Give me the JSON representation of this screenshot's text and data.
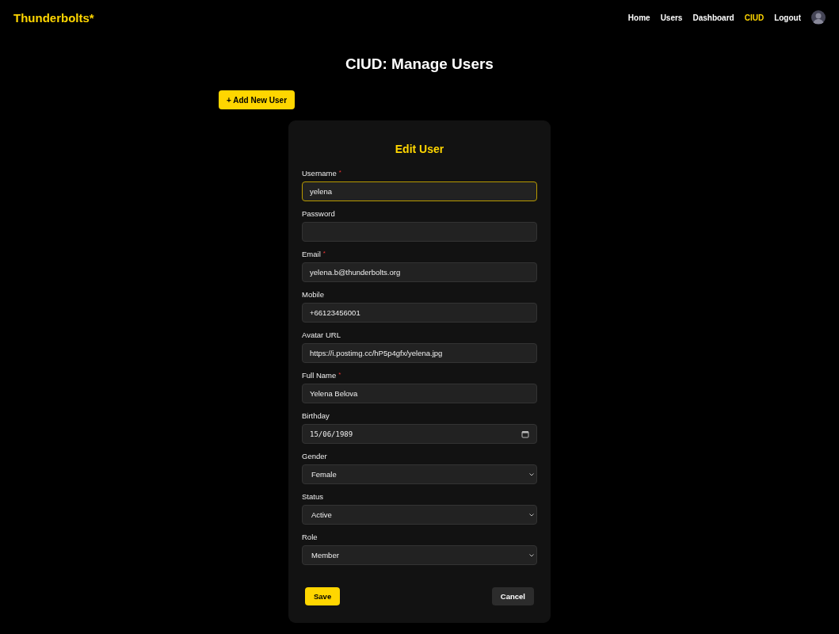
{
  "navbar": {
    "brand": "Thunderbolts*",
    "links": [
      {
        "label": "Home",
        "selected": false
      },
      {
        "label": "Users",
        "selected": false
      },
      {
        "label": "Dashboard",
        "selected": false
      },
      {
        "label": "CIUD",
        "selected": true
      },
      {
        "label": "Logout",
        "selected": false
      }
    ]
  },
  "page": {
    "title": "CIUD: Manage Users",
    "add_button": "+ Add New User"
  },
  "form": {
    "title": "Edit User",
    "fields": [
      {
        "kind": "text",
        "label": "Username",
        "required_mark": "*",
        "value": "yelena",
        "focused": true
      },
      {
        "kind": "text",
        "label": "Password",
        "focused": false
      },
      {
        "kind": "text",
        "label": "Email",
        "required_mark": "*",
        "value": "yelena.b@thunderbolts.org",
        "focused": false
      },
      {
        "kind": "text",
        "label": "Mobile",
        "value": "+66123456001",
        "focused": false
      },
      {
        "kind": "text",
        "label": "Avatar URL",
        "value": "https://i.postimg.cc/hP5p4gfx/yelena.jpg",
        "focused": false
      },
      {
        "kind": "text",
        "label": "Full Name",
        "required_mark": "*",
        "value": "Yelena Belova",
        "focused": false
      },
      {
        "kind": "date",
        "label": "Birthday",
        "value": "15/06/1989",
        "focused": false
      },
      {
        "kind": "select",
        "label": "Gender",
        "value": "Female",
        "focused": false
      },
      {
        "kind": "select",
        "label": "Status",
        "value": "Active",
        "focused": false
      },
      {
        "kind": "select",
        "label": "Role",
        "value": "Member",
        "focused": false
      }
    ],
    "save_button": "Save",
    "cancel_button": "Cancel"
  }
}
